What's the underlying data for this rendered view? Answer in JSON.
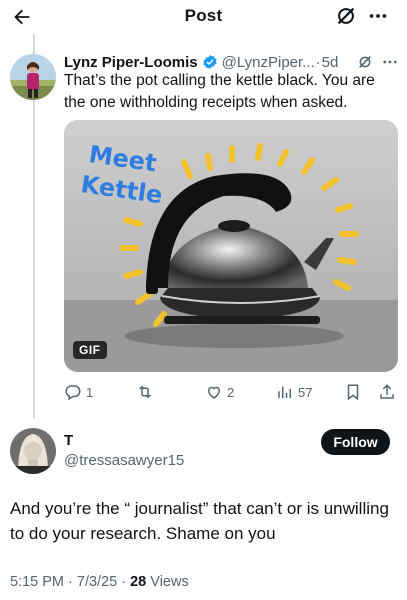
{
  "header": {
    "title": "Post"
  },
  "tweet1": {
    "name": "Lynz Piper-Loomis",
    "handle": "@LynzPiper...",
    "separator": "·",
    "time": "5d",
    "text": "That’s the pot calling the kettle black. You are the one withholding receipts when asked.",
    "gif": {
      "caption_line1": "Meet",
      "caption_line2": "Kettle",
      "badge": "GIF"
    },
    "actions": {
      "replies": "1",
      "reposts": "",
      "likes": "2",
      "views": "57"
    }
  },
  "tweet2": {
    "name": "T",
    "handle": "@tressasawyer15",
    "follow_label": "Follow",
    "text": "And you’re the “ journalist” that can’t or is unwilling to do your research. Shame on you",
    "time": "5:15 PM",
    "dot1": " · ",
    "date": "7/3/25",
    "dot2": " · ",
    "views_count": "28",
    "views_label": " Views"
  },
  "colors": {
    "accent": "#1d9bf0",
    "text": "#0f1419",
    "secondary": "#536471",
    "gif_text": "#2f7de1",
    "gif_rays": "#f2c12e"
  }
}
